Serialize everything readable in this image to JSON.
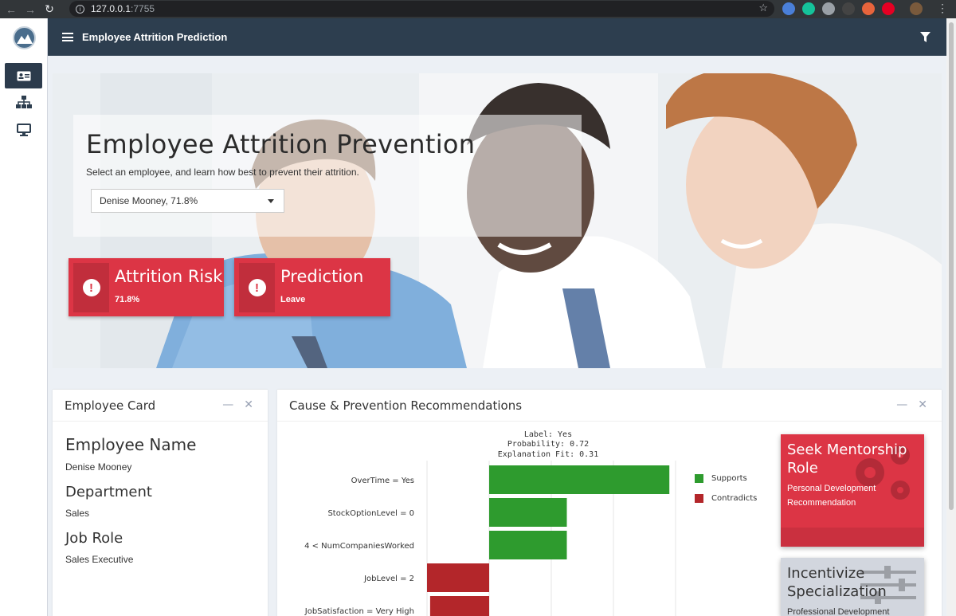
{
  "browser": {
    "url_host": "127.0.0.1",
    "url_port": ":7755"
  },
  "app": {
    "title": "Employee Attrition Prediction"
  },
  "sidebar": {
    "items": [
      {
        "icon": "id-card-icon",
        "active": true
      },
      {
        "icon": "sitemap-icon",
        "active": false
      },
      {
        "icon": "desktop-icon",
        "active": false
      }
    ]
  },
  "hero": {
    "title": "Employee Attrition Prevention",
    "subtitle": "Select an employee, and learn how best to prevent their attrition.",
    "select_value": "Denise Mooney, 71.8%"
  },
  "info_boxes": [
    {
      "label": "Attrition Risk",
      "value": "71.8%",
      "color": "#dc3545",
      "icon": "exclamation-circle-icon"
    },
    {
      "label": "Prediction",
      "value": "Leave",
      "color": "#dc3545",
      "icon": "exclamation-circle-icon"
    }
  ],
  "employee_card": {
    "header": "Employee Card",
    "fields": [
      {
        "title": "Employee Name",
        "value": "Denise Mooney"
      },
      {
        "title": "Department",
        "value": "Sales"
      },
      {
        "title": "Job Role",
        "value": "Sales Executive"
      }
    ]
  },
  "recommendations_card": {
    "header": "Cause & Prevention Recommendations",
    "explanation": {
      "label_line": "Label: Yes",
      "probability_line": "Probability: 0.72",
      "fit_line": "Explanation Fit: 0.31"
    },
    "legend": [
      {
        "name": "Supports",
        "color": "#2e9b2e"
      },
      {
        "name": "Contradicts",
        "color": "#b3262a"
      }
    ],
    "recommendations": [
      {
        "title": "Seek Mentorship Role",
        "subtitle": "Personal Development Recommendation",
        "color": "#dc3545",
        "icon": "gears-icon"
      },
      {
        "title": "Incentivize Specialization",
        "subtitle": "Professional Development",
        "color": "#d2d6de",
        "icon": "sliders-icon"
      }
    ]
  },
  "chart_data": {
    "type": "bar",
    "orientation": "horizontal",
    "categories": [
      "OverTime = Yes",
      "StockOptionLevel = 0",
      "4 < NumCompaniesWorked",
      "JobLevel = 2",
      "JobSatisfaction = Very High"
    ],
    "values": [
      0.29,
      0.125,
      0.125,
      -0.1,
      -0.095
    ],
    "series_colors": {
      "supports": "#2e9b2e",
      "contradicts": "#b3262a"
    },
    "legend_position": "right",
    "grid": true
  }
}
